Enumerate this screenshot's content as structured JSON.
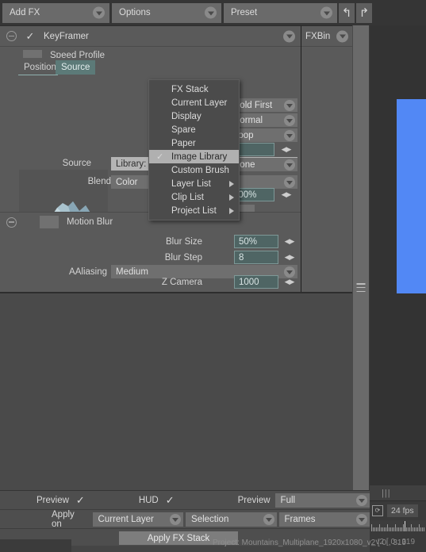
{
  "toolbar": {
    "add_fx": "Add FX",
    "options": "Options",
    "preset": "Preset",
    "undo_icon": "↰",
    "redo_icon": "↱"
  },
  "fx_stack": {
    "keyframer": {
      "title": "KeyFramer",
      "enabled_icon": "✓",
      "collapse_icon": "⊖"
    },
    "speed_profile": "Speed Profile",
    "fxbin_label": "FXBin"
  },
  "tabs": [
    {
      "label": "Position",
      "active": false
    },
    {
      "label": "Source",
      "active": true
    }
  ],
  "source_panel": {
    "source_label": "Source",
    "source_value": "Library: n",
    "hidden_field_value": "",
    "hold_first": "Hold First",
    "normal": "Normal",
    "loop": "Loop",
    "number_field": "0",
    "none": "None",
    "blend_label": "Blend",
    "blend_value": "Color",
    "percent_field": "100%"
  },
  "motion_blur": {
    "label": "Motion Blur",
    "collapse_icon": "⊖",
    "blur_size_label": "Blur Size",
    "blur_size_value": "50%",
    "blur_step_label": "Blur Step",
    "blur_step_value": "8",
    "aaliasing_label": "AAliasing",
    "aaliasing_value": "Medium",
    "z_camera_label": "Z Camera",
    "z_camera_value": "1000"
  },
  "menu": {
    "items": [
      {
        "label": "FX Stack",
        "checked": false,
        "submenu": false
      },
      {
        "label": "Current Layer",
        "checked": false,
        "submenu": false
      },
      {
        "label": "Display",
        "checked": false,
        "submenu": false
      },
      {
        "label": "Spare",
        "checked": false,
        "submenu": false
      },
      {
        "label": "Paper",
        "checked": false,
        "submenu": false
      },
      {
        "label": "Image Library",
        "checked": true,
        "submenu": false
      },
      {
        "label": "Custom Brush",
        "checked": false,
        "submenu": false
      },
      {
        "label": "Layer List",
        "checked": false,
        "submenu": true
      },
      {
        "label": "Clip List",
        "checked": false,
        "submenu": true
      },
      {
        "label": "Project List",
        "checked": false,
        "submenu": true
      }
    ],
    "check_glyph": "✓"
  },
  "bottom": {
    "preview_label": "Preview",
    "preview_check": "✓",
    "hud_label": "HUD",
    "hud_check": "✓",
    "preview2_label": "Preview",
    "preview2_value": "Full",
    "apply_on_label": "Apply on",
    "apply_on_value": "Current Layer",
    "selection_value": "Selection",
    "frames_value": "Frames",
    "apply_button": "Apply FX Stack",
    "project_status": "Project: Mountains_Multiplane_1920x1080_v2 [ 0 , 319"
  },
  "timeline": {
    "fps": "24 fps",
    "bars_icon": "|||",
    "loop_icon": "⟳",
    "status": "_v2 [ 0 , 319"
  },
  "colors": {
    "accent_blue": "#5288f5",
    "tab_active": "#5c7a78",
    "field_teal": "#4f6564",
    "panel_grey": "#5a5a5a"
  }
}
